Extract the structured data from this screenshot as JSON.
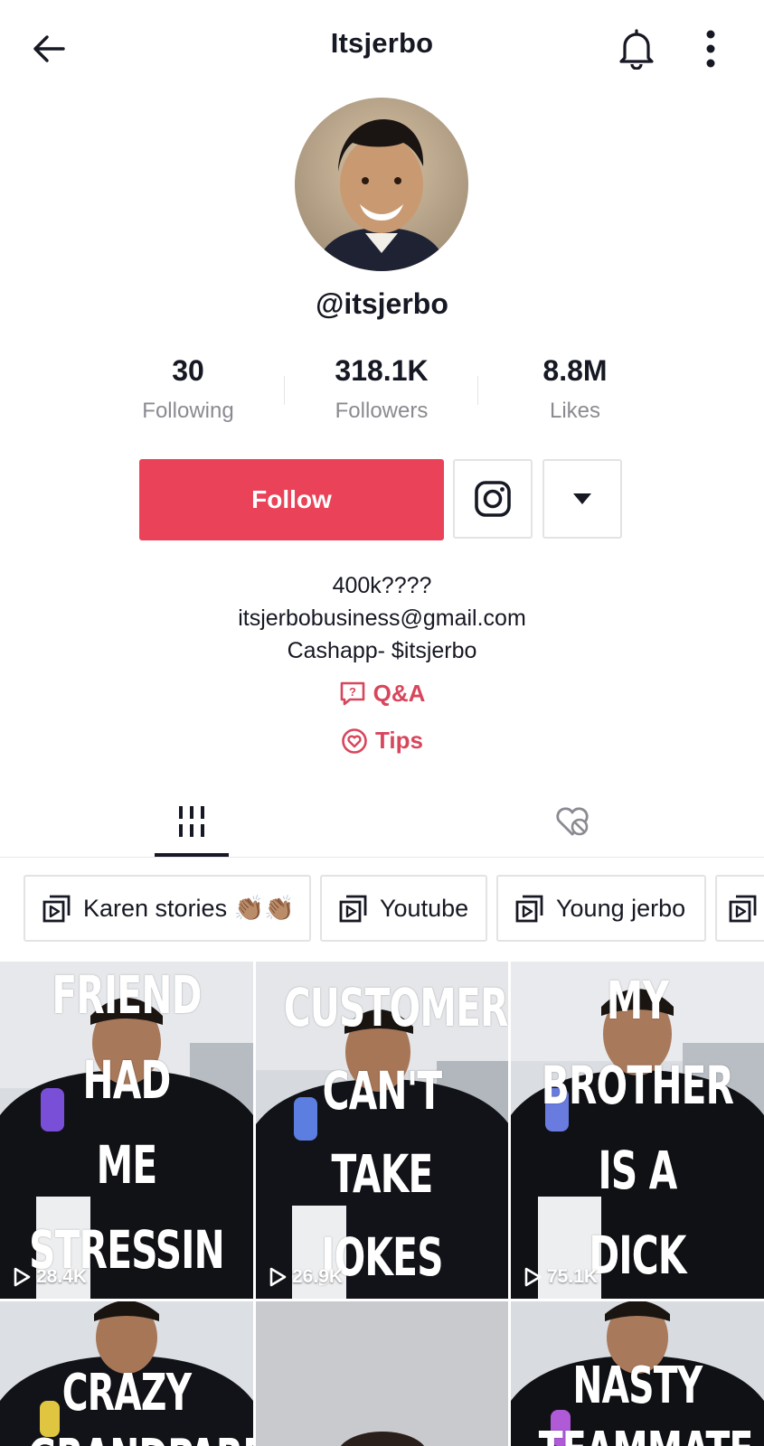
{
  "header": {
    "title": "Itsjerbo"
  },
  "profile": {
    "handle": "@itsjerbo",
    "stats": [
      {
        "value": "30",
        "label": "Following"
      },
      {
        "value": "318.1K",
        "label": "Followers"
      },
      {
        "value": "8.8M",
        "label": "Likes"
      }
    ],
    "follow_label": "Follow",
    "bio": [
      "400k????",
      "itsjerbobusiness@gmail.com",
      "Cashapp- $itsjerbo"
    ],
    "links": [
      {
        "label": "Q&A",
        "icon": "question-bubble-icon"
      },
      {
        "label": "Tips",
        "icon": "heart-badge-icon"
      }
    ]
  },
  "playlists": [
    {
      "label": "Karen stories 👏🏽👏🏽"
    },
    {
      "label": "Youtube"
    },
    {
      "label": "Young jerbo"
    }
  ],
  "videos": [
    {
      "lines": [
        "FRIEND",
        "HAD",
        "ME",
        "STRESSIN"
      ],
      "views": "28.4K"
    },
    {
      "lines": [
        "CUSTOMER",
        "CAN'T",
        "TAKE",
        "JOKES"
      ],
      "views": "26.9K"
    },
    {
      "lines": [
        "MY",
        "BROTHER",
        "IS A",
        "DICK"
      ],
      "views": "75.1K"
    },
    {
      "lines": [
        "CRAZY",
        "GRANDPARENT"
      ],
      "views": ""
    },
    {
      "lines": [],
      "views": ""
    },
    {
      "lines": [
        "NASTY",
        "TEAMMATE"
      ],
      "views": ""
    }
  ],
  "colors": {
    "accent": "#ea4359",
    "link": "#d8465c",
    "text": "#161823",
    "muted": "#8a8b91"
  }
}
